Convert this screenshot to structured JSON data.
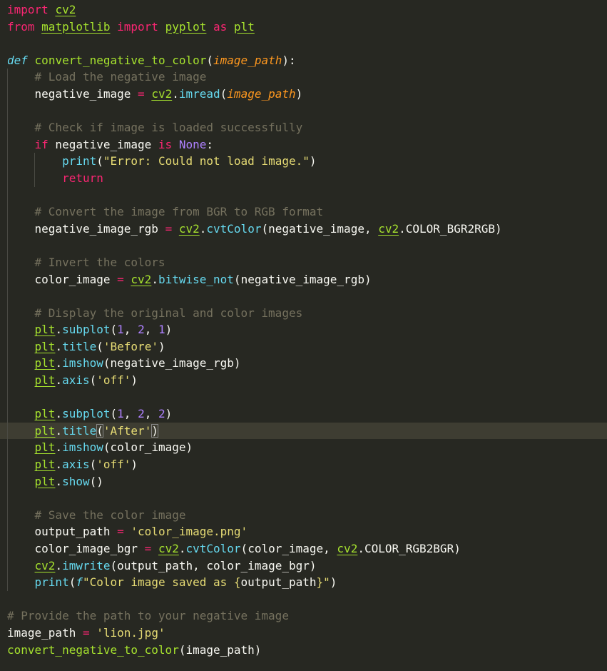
{
  "editor": {
    "lines": [
      {
        "indent": 0,
        "tokens": [
          [
            "kw",
            "import"
          ],
          [
            "t",
            " "
          ],
          [
            "mod",
            "cv2"
          ]
        ]
      },
      {
        "indent": 0,
        "tokens": [
          [
            "kw",
            "from"
          ],
          [
            "t",
            " "
          ],
          [
            "mod",
            "matplotlib"
          ],
          [
            "t",
            " "
          ],
          [
            "kw",
            "import"
          ],
          [
            "t",
            " "
          ],
          [
            "mod",
            "pyplot"
          ],
          [
            "t",
            " "
          ],
          [
            "kw",
            "as"
          ],
          [
            "t",
            " "
          ],
          [
            "mod",
            "plt"
          ]
        ]
      },
      {
        "indent": 0,
        "tokens": []
      },
      {
        "indent": 0,
        "tokens": [
          [
            "def",
            "def"
          ],
          [
            "t",
            " "
          ],
          [
            "fn",
            "convert_negative_to_color"
          ],
          [
            "pun",
            "("
          ],
          [
            "param",
            "image_path"
          ],
          [
            "pun",
            "):"
          ]
        ]
      },
      {
        "indent": 1,
        "tokens": [
          [
            "t",
            "    "
          ],
          [
            "cmt",
            "# Load the negative image"
          ]
        ]
      },
      {
        "indent": 1,
        "tokens": [
          [
            "t",
            "    negative_image "
          ],
          [
            "kw",
            "="
          ],
          [
            "t",
            " "
          ],
          [
            "mod",
            "cv2"
          ],
          [
            "pun",
            "."
          ],
          [
            "call",
            "imread"
          ],
          [
            "pun",
            "("
          ],
          [
            "param",
            "image_path"
          ],
          [
            "pun",
            ")"
          ]
        ]
      },
      {
        "indent": 1,
        "tokens": []
      },
      {
        "indent": 1,
        "tokens": [
          [
            "t",
            "    "
          ],
          [
            "cmt",
            "# Check if image is loaded successfully"
          ]
        ]
      },
      {
        "indent": 1,
        "tokens": [
          [
            "t",
            "    "
          ],
          [
            "kw",
            "if"
          ],
          [
            "t",
            " negative_image "
          ],
          [
            "kw",
            "is"
          ],
          [
            "t",
            " "
          ],
          [
            "const",
            "None"
          ],
          [
            "pun",
            ":"
          ]
        ]
      },
      {
        "indent": 2,
        "tokens": [
          [
            "t",
            "        "
          ],
          [
            "call",
            "print"
          ],
          [
            "pun",
            "("
          ],
          [
            "str",
            "\"Error: Could not load image.\""
          ],
          [
            "pun",
            ")"
          ]
        ]
      },
      {
        "indent": 2,
        "tokens": [
          [
            "t",
            "        "
          ],
          [
            "kw",
            "return"
          ]
        ]
      },
      {
        "indent": 1,
        "tokens": []
      },
      {
        "indent": 1,
        "tokens": [
          [
            "t",
            "    "
          ],
          [
            "cmt",
            "# Convert the image from BGR to RGB format"
          ]
        ]
      },
      {
        "indent": 1,
        "tokens": [
          [
            "t",
            "    negative_image_rgb "
          ],
          [
            "kw",
            "="
          ],
          [
            "t",
            " "
          ],
          [
            "mod",
            "cv2"
          ],
          [
            "pun",
            "."
          ],
          [
            "call",
            "cvtColor"
          ],
          [
            "pun",
            "("
          ],
          [
            "t",
            "negative_image, "
          ],
          [
            "mod",
            "cv2"
          ],
          [
            "pun",
            "."
          ],
          [
            "t",
            "COLOR_BGR2RGB"
          ],
          [
            "pun",
            ")"
          ]
        ]
      },
      {
        "indent": 1,
        "tokens": []
      },
      {
        "indent": 1,
        "tokens": [
          [
            "t",
            "    "
          ],
          [
            "cmt",
            "# Invert the colors"
          ]
        ]
      },
      {
        "indent": 1,
        "tokens": [
          [
            "t",
            "    color_image "
          ],
          [
            "kw",
            "="
          ],
          [
            "t",
            " "
          ],
          [
            "mod",
            "cv2"
          ],
          [
            "pun",
            "."
          ],
          [
            "call",
            "bitwise_not"
          ],
          [
            "pun",
            "("
          ],
          [
            "t",
            "negative_image_rgb"
          ],
          [
            "pun",
            ")"
          ]
        ]
      },
      {
        "indent": 1,
        "tokens": []
      },
      {
        "indent": 1,
        "tokens": [
          [
            "t",
            "    "
          ],
          [
            "cmt",
            "# Display the original and color images"
          ]
        ]
      },
      {
        "indent": 1,
        "tokens": [
          [
            "t",
            "    "
          ],
          [
            "mod",
            "plt"
          ],
          [
            "pun",
            "."
          ],
          [
            "call",
            "subplot"
          ],
          [
            "pun",
            "("
          ],
          [
            "num",
            "1"
          ],
          [
            "pun",
            ", "
          ],
          [
            "num",
            "2"
          ],
          [
            "pun",
            ", "
          ],
          [
            "num",
            "1"
          ],
          [
            "pun",
            ")"
          ]
        ]
      },
      {
        "indent": 1,
        "tokens": [
          [
            "t",
            "    "
          ],
          [
            "mod",
            "plt"
          ],
          [
            "pun",
            "."
          ],
          [
            "call",
            "title"
          ],
          [
            "pun",
            "("
          ],
          [
            "str",
            "'Before'"
          ],
          [
            "pun",
            ")"
          ]
        ]
      },
      {
        "indent": 1,
        "tokens": [
          [
            "t",
            "    "
          ],
          [
            "mod",
            "plt"
          ],
          [
            "pun",
            "."
          ],
          [
            "call",
            "imshow"
          ],
          [
            "pun",
            "("
          ],
          [
            "t",
            "negative_image_rgb"
          ],
          [
            "pun",
            ")"
          ]
        ]
      },
      {
        "indent": 1,
        "tokens": [
          [
            "t",
            "    "
          ],
          [
            "mod",
            "plt"
          ],
          [
            "pun",
            "."
          ],
          [
            "call",
            "axis"
          ],
          [
            "pun",
            "("
          ],
          [
            "str",
            "'off'"
          ],
          [
            "pun",
            ")"
          ]
        ]
      },
      {
        "indent": 1,
        "tokens": []
      },
      {
        "indent": 1,
        "tokens": [
          [
            "t",
            "    "
          ],
          [
            "mod",
            "plt"
          ],
          [
            "pun",
            "."
          ],
          [
            "call",
            "subplot"
          ],
          [
            "pun",
            "("
          ],
          [
            "num",
            "1"
          ],
          [
            "pun",
            ", "
          ],
          [
            "num",
            "2"
          ],
          [
            "pun",
            ", "
          ],
          [
            "num",
            "2"
          ],
          [
            "pun",
            ")"
          ]
        ]
      },
      {
        "indent": 1,
        "current": true,
        "tokens": [
          [
            "t",
            "    "
          ],
          [
            "mod",
            "plt"
          ],
          [
            "pun",
            "."
          ],
          [
            "call",
            "title"
          ],
          [
            "brk",
            "("
          ],
          [
            "str",
            "'After'"
          ],
          [
            "brk",
            ")"
          ]
        ]
      },
      {
        "indent": 1,
        "tokens": [
          [
            "t",
            "    "
          ],
          [
            "mod",
            "plt"
          ],
          [
            "pun",
            "."
          ],
          [
            "call",
            "imshow"
          ],
          [
            "pun",
            "("
          ],
          [
            "t",
            "color_image"
          ],
          [
            "pun",
            ")"
          ]
        ]
      },
      {
        "indent": 1,
        "tokens": [
          [
            "t",
            "    "
          ],
          [
            "mod",
            "plt"
          ],
          [
            "pun",
            "."
          ],
          [
            "call",
            "axis"
          ],
          [
            "pun",
            "("
          ],
          [
            "str",
            "'off'"
          ],
          [
            "pun",
            ")"
          ]
        ]
      },
      {
        "indent": 1,
        "tokens": [
          [
            "t",
            "    "
          ],
          [
            "mod",
            "plt"
          ],
          [
            "pun",
            "."
          ],
          [
            "call",
            "show"
          ],
          [
            "pun",
            "()"
          ]
        ]
      },
      {
        "indent": 1,
        "tokens": []
      },
      {
        "indent": 1,
        "tokens": [
          [
            "t",
            "    "
          ],
          [
            "cmt",
            "# Save the color image"
          ]
        ]
      },
      {
        "indent": 1,
        "tokens": [
          [
            "t",
            "    output_path "
          ],
          [
            "kw",
            "="
          ],
          [
            "t",
            " "
          ],
          [
            "str",
            "'color_image.png'"
          ]
        ]
      },
      {
        "indent": 1,
        "tokens": [
          [
            "t",
            "    color_image_bgr "
          ],
          [
            "kw",
            "="
          ],
          [
            "t",
            " "
          ],
          [
            "mod",
            "cv2"
          ],
          [
            "pun",
            "."
          ],
          [
            "call",
            "cvtColor"
          ],
          [
            "pun",
            "("
          ],
          [
            "t",
            "color_image, "
          ],
          [
            "mod",
            "cv2"
          ],
          [
            "pun",
            "."
          ],
          [
            "t",
            "COLOR_RGB2BGR"
          ],
          [
            "pun",
            ")"
          ]
        ]
      },
      {
        "indent": 1,
        "tokens": [
          [
            "t",
            "    "
          ],
          [
            "mod",
            "cv2"
          ],
          [
            "pun",
            "."
          ],
          [
            "call",
            "imwrite"
          ],
          [
            "pun",
            "("
          ],
          [
            "t",
            "output_path, color_image_bgr"
          ],
          [
            "pun",
            ")"
          ]
        ]
      },
      {
        "indent": 1,
        "tokens": [
          [
            "t",
            "    "
          ],
          [
            "call",
            "print"
          ],
          [
            "pun",
            "("
          ],
          [
            "fpre",
            "f"
          ],
          [
            "str",
            "\"Color image saved as "
          ],
          [
            "br",
            "{"
          ],
          [
            "t",
            "output_path"
          ],
          [
            "br",
            "}"
          ],
          [
            "str",
            "\""
          ],
          [
            "pun",
            ")"
          ]
        ]
      },
      {
        "indent": 0,
        "tokens": []
      },
      {
        "indent": 0,
        "tokens": [
          [
            "cmt",
            "# Provide the path to your negative image"
          ]
        ]
      },
      {
        "indent": 0,
        "tokens": [
          [
            "t",
            "image_path "
          ],
          [
            "kw",
            "="
          ],
          [
            "t",
            " "
          ],
          [
            "str",
            "'lion.jpg'"
          ]
        ]
      },
      {
        "indent": 0,
        "tokens": [
          [
            "fn",
            "convert_negative_to_color"
          ],
          [
            "pun",
            "("
          ],
          [
            "t",
            "image_path"
          ],
          [
            "pun",
            ")"
          ]
        ]
      }
    ]
  }
}
